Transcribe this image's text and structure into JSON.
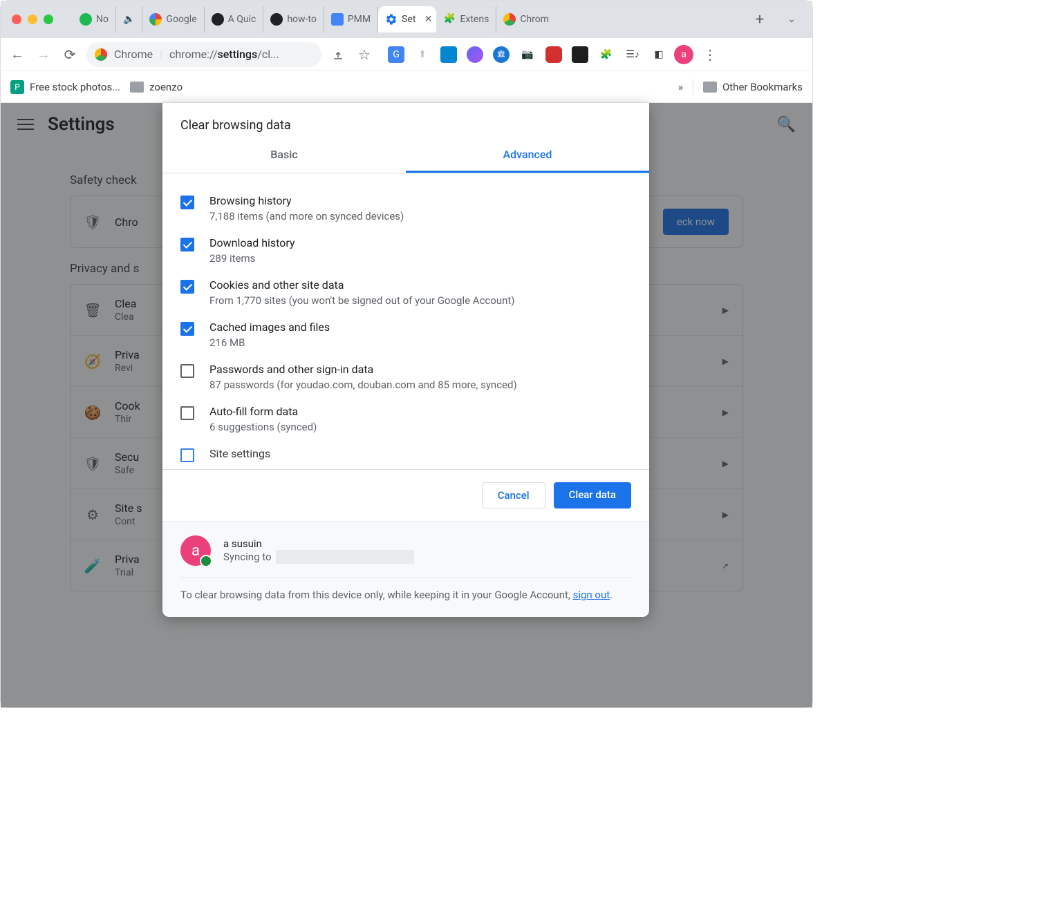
{
  "titlebar": {
    "tabs": [
      {
        "label": "No"
      },
      {
        "label": "Google"
      },
      {
        "label": "A Quic"
      },
      {
        "label": "how-to"
      },
      {
        "label": "PMM"
      },
      {
        "label": "Set",
        "active": true
      },
      {
        "label": "Extens"
      },
      {
        "label": "Chrom"
      }
    ]
  },
  "toolbar": {
    "chrome_label": "Chrome",
    "url_pre": "chrome://",
    "url_bold": "settings",
    "url_post": "/cl..."
  },
  "bookmarks": {
    "item1": "Free stock photos...",
    "item2": "zoenzo",
    "overflow": "»",
    "other": "Other Bookmarks"
  },
  "settings": {
    "title": "Settings",
    "safety_label": "Safety check",
    "safety_row_title": "Chro",
    "check_now": "eck now",
    "privacy_label": "Privacy and s",
    "rows": [
      {
        "title": "Clea",
        "sub": "Clea"
      },
      {
        "title": "Priva",
        "sub": "Revi"
      },
      {
        "title": "Cook",
        "sub": "Thir"
      },
      {
        "title": "Secu",
        "sub": "Safe"
      },
      {
        "title": "Site s",
        "sub": "Cont"
      },
      {
        "title": "Priva",
        "sub": "Trial"
      }
    ]
  },
  "dialog": {
    "title": "Clear browsing data",
    "tab_basic": "Basic",
    "tab_advanced": "Advanced",
    "options": [
      {
        "title": "Browsing history",
        "sub": "7,188 items (and more on synced devices)",
        "checked": true
      },
      {
        "title": "Download history",
        "sub": "289 items",
        "checked": true
      },
      {
        "title": "Cookies and other site data",
        "sub": "From 1,770 sites (you won't be signed out of your Google Account)",
        "checked": true
      },
      {
        "title": "Cached images and files",
        "sub": "216 MB",
        "checked": true
      },
      {
        "title": "Passwords and other sign-in data",
        "sub": "87 passwords (for youdao.com, douban.com and 85 more, synced)",
        "checked": false
      },
      {
        "title": "Auto-fill form data",
        "sub": "6 suggestions (synced)",
        "checked": false
      },
      {
        "title": "Site settings",
        "sub": "",
        "checked": false
      }
    ],
    "cancel": "Cancel",
    "clear": "Clear data",
    "user_name": "a susuin",
    "syncing_to": "Syncing to",
    "footer_pre": "To clear browsing data from this device only, while keeping it in your Google Account, ",
    "signout": "sign out",
    "avatar_letter": "a"
  }
}
